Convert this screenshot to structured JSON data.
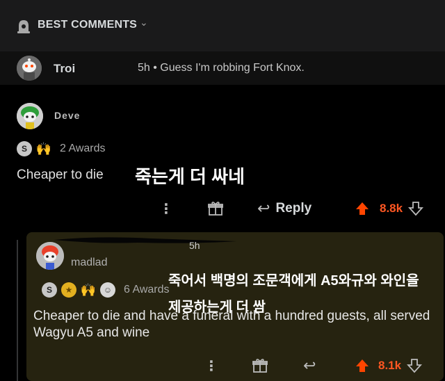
{
  "header": {
    "title": "BEST COMMENTS",
    "chevron_icon": "chevron-down-icon"
  },
  "comment1": {
    "author": "Troi",
    "meta": "5h • Guess I'm robbing Fort Knox."
  },
  "comment2": {
    "author": "Deve",
    "awards_label": "2 Awards",
    "text": "Cheaper to die",
    "translation": "죽는게 더 싸네",
    "reply_label": "Reply",
    "score": "8.8k"
  },
  "comment3": {
    "author_suffix": "5h",
    "flair": "madlad",
    "awards_label": "6 Awards",
    "translation_line1": "죽어서 백명의 조문객에게 A5와규와 와인을",
    "translation_line2": "제공하는게 더 쌈",
    "text": "Cheaper to die and have a funeral with a hundred guests, all served Wagyu A5 and wine",
    "score": "8.1k"
  },
  "colors": {
    "upvote": "#ff4500",
    "score": "#ff5722",
    "background": "#000000"
  }
}
